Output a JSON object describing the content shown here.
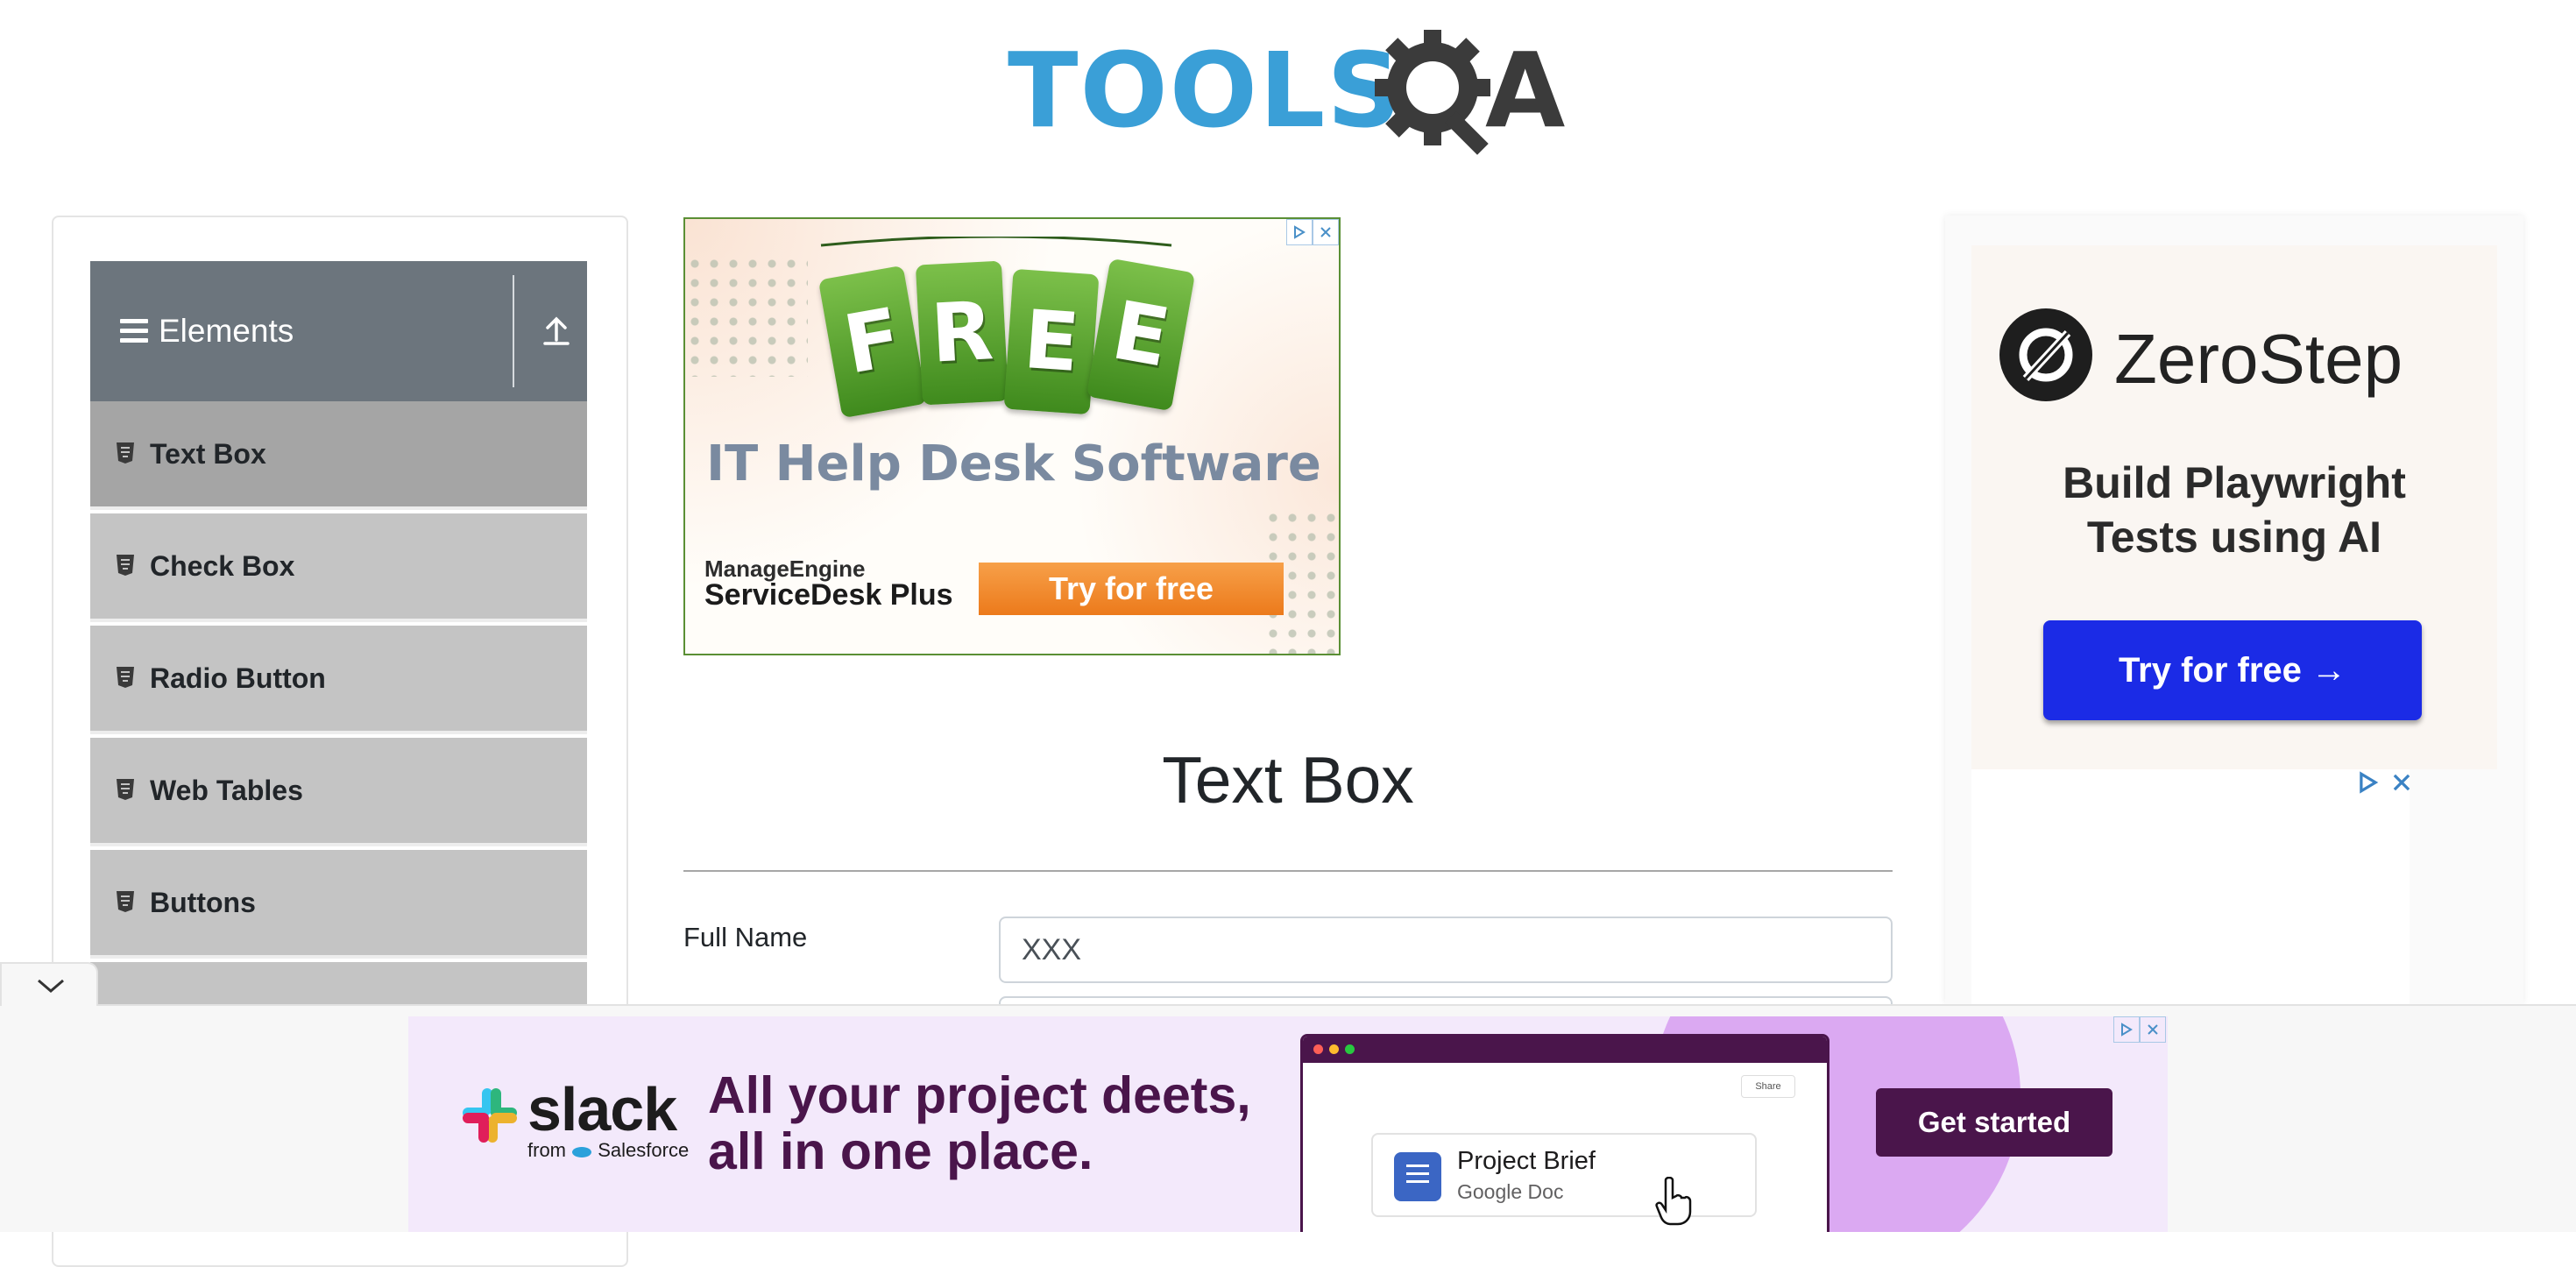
{
  "header": {
    "logo_text": "TOOLS",
    "logo_tail": "A"
  },
  "sidebar": {
    "group": {
      "title": "Elements"
    },
    "items": [
      {
        "label": "Text Box",
        "active": true
      },
      {
        "label": "Check Box"
      },
      {
        "label": "Radio Button"
      },
      {
        "label": "Web Tables"
      },
      {
        "label": "Buttons"
      }
    ]
  },
  "ad_top": {
    "tags": [
      "F",
      "R",
      "E",
      "E"
    ],
    "headline": "IT Help Desk Software",
    "brand_line1": "ManageEngine",
    "brand_line2": "ServiceDesk Plus",
    "cta": "Try for free"
  },
  "main": {
    "title": "Text Box",
    "full_name_label": "Full Name",
    "full_name_value": "XXX"
  },
  "ad_right": {
    "brand": "ZeroStep",
    "tagline_line1": "Build Playwright",
    "tagline_line2": "Tests using AI",
    "cta": "Try for free →"
  },
  "banner": {
    "brand": "slack",
    "from": "from",
    "partner": "Salesforce",
    "headline_line1": "All your project deets,",
    "headline_line2": "all in one place.",
    "share": "Share",
    "doc_title": "Project Brief",
    "doc_subtitle": "Google Doc",
    "cta": "Get started"
  },
  "colors": {
    "logo_blue": "#3a9fd7",
    "sidebar_header": "#6c757d",
    "menu_item": "#c4c4c4",
    "menu_item_active": "#a5a5a5",
    "zerostep_cta": "#1b2be6",
    "slack_purple": "#4a154b",
    "ad_orange": "#ec7a1b"
  }
}
